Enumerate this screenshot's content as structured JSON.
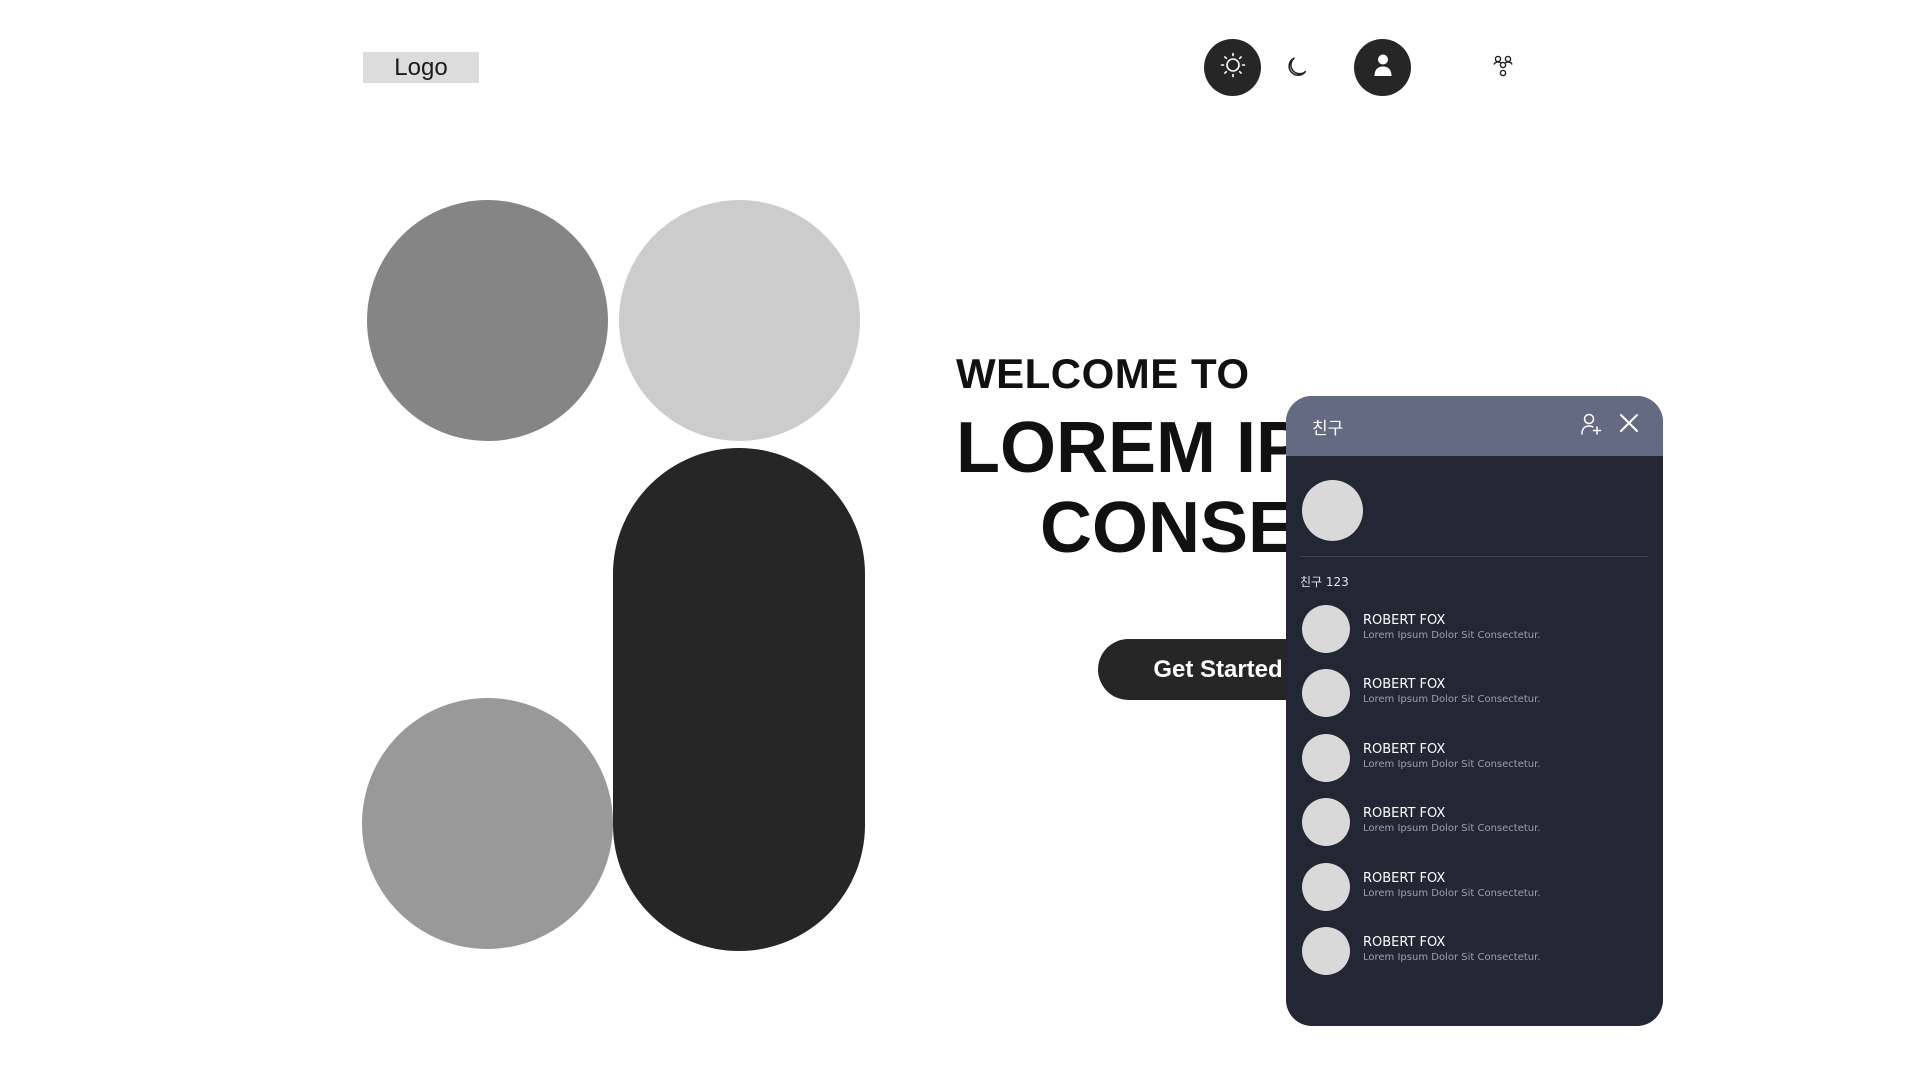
{
  "header": {
    "logo_text": "Logo",
    "icons": {
      "light_mode": "sun-icon",
      "dark_mode": "moon-icon",
      "profile": "user-icon",
      "friends": "friends-icon"
    }
  },
  "hero": {
    "welcome": "WELCOME TO",
    "headline_line1": "LOREM IPS",
    "headline_line2": "CONSEC",
    "cta_label": "Get Started"
  },
  "friends_panel": {
    "title": "친구",
    "count_label": "친구 123",
    "icons": {
      "add_friend": "add-user-icon",
      "close": "close-icon"
    },
    "friends": [
      {
        "name": "ROBERT FOX",
        "status": "Lorem Ipsum Dolor Sit Consectetur."
      },
      {
        "name": "ROBERT FOX",
        "status": "Lorem Ipsum Dolor Sit Consectetur."
      },
      {
        "name": "ROBERT FOX",
        "status": "Lorem Ipsum Dolor Sit Consectetur."
      },
      {
        "name": "ROBERT FOX",
        "status": "Lorem Ipsum Dolor Sit Consectetur."
      },
      {
        "name": "ROBERT FOX",
        "status": "Lorem Ipsum Dolor Sit Consectetur."
      },
      {
        "name": "ROBERT FOX",
        "status": "Lorem Ipsum Dolor Sit Consectetur."
      }
    ]
  },
  "colors": {
    "dark": "#262626",
    "panel_bg": "#222733",
    "panel_header": "#636a82",
    "avatar_placeholder": "#d9d9d9"
  }
}
